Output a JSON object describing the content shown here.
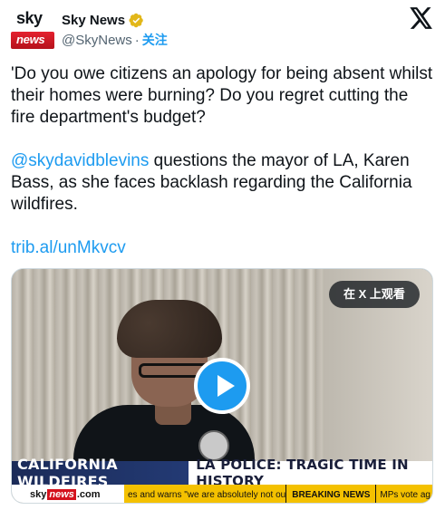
{
  "header": {
    "display_name": "Sky News",
    "handle": "@SkyNews",
    "separator": "·",
    "follow_label": "关注",
    "avatar": {
      "top_word": "sky",
      "bottom_word": "news"
    }
  },
  "tweet": {
    "paragraph_1": "'Do you owe citizens an apology for being absent whilst their homes were burning? Do you regret cutting the fire department's budget?",
    "mention": "@skydavidblevins",
    "paragraph_2_rest": " questions the mayor of LA, Karen Bass, as she faces backlash regarding the California wildfires.",
    "link": "trib.al/unMkvcv"
  },
  "media": {
    "watch_on_x_label": "在 X 上观看",
    "lower_third_tag": "CALIFORNIA WILDFIRES",
    "lower_third_headline": "LA POLICE: TRAGIC TIME IN HISTORY",
    "ticker": {
      "logo_sky": "sky",
      "logo_news": "news",
      "logo_com": ".com",
      "text": "es and warns \"we are absolutely not out of danger\"",
      "breaking_label": "BREAKING NEWS",
      "tail": "MPs vote ag"
    }
  },
  "colors": {
    "accent": "#1d9bf0",
    "verified_gold": "#e2b719",
    "sky_red": "#d4121d",
    "ticker_yellow": "#f4c100",
    "lower_third_blue": "#1b2b58"
  },
  "icons": {
    "verified": "verified-badge-icon",
    "x_logo": "x-logo-icon",
    "play": "play-icon"
  }
}
